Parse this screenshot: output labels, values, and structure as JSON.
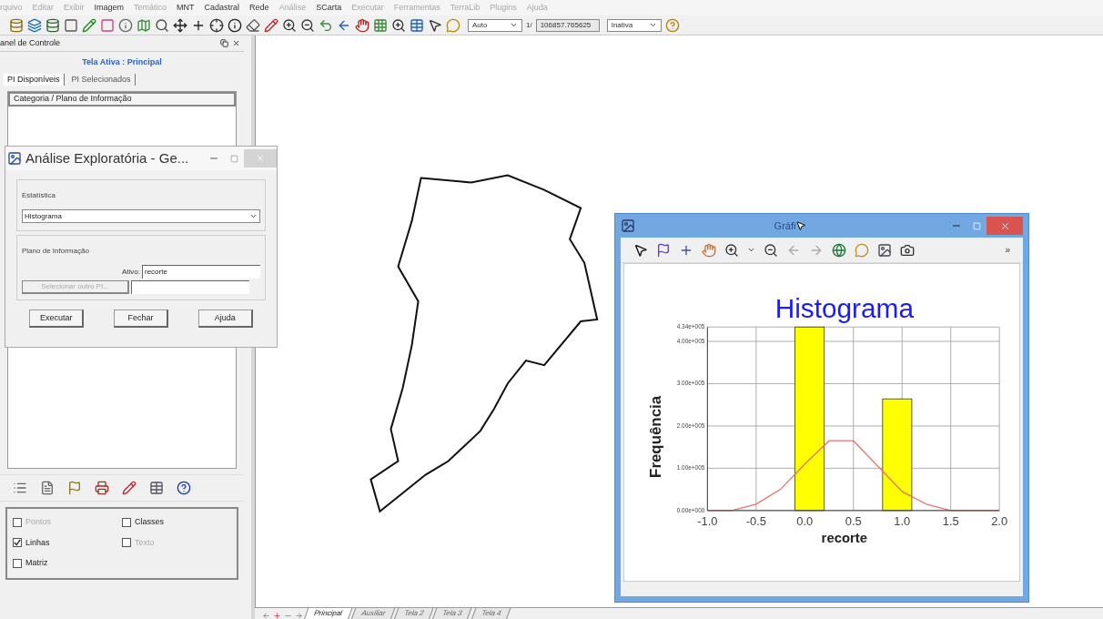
{
  "menu": [
    {
      "label": "rquivo",
      "disabled": true
    },
    {
      "label": "Editar",
      "disabled": true
    },
    {
      "label": "Exibir",
      "disabled": true
    },
    {
      "label": "Imagem",
      "disabled": false
    },
    {
      "label": "Temático",
      "disabled": true
    },
    {
      "label": "MNT",
      "disabled": false
    },
    {
      "label": "Cadastral",
      "disabled": false
    },
    {
      "label": "Rede",
      "disabled": false
    },
    {
      "label": "Análise",
      "disabled": true
    },
    {
      "label": "SCarta",
      "disabled": false
    },
    {
      "label": "Executar",
      "disabled": true
    },
    {
      "label": "Ferramentas",
      "disabled": true
    },
    {
      "label": "TerraLib",
      "disabled": true
    },
    {
      "label": "Plugins",
      "disabled": true
    },
    {
      "label": "Ajuda",
      "disabled": true
    }
  ],
  "toolbar": {
    "zoom_mode": "Auto",
    "scale_prefix": "1/",
    "scale": "106857.765625",
    "status": "Inativa"
  },
  "control_panel": {
    "title": "anel de Controle",
    "active_view": "Tela Ativa : Principal",
    "tabs": [
      {
        "label": "PI Disponíveis",
        "selected": true
      },
      {
        "label": "PI Selecionados",
        "selected": false
      }
    ],
    "tree_header": "Categoria / Plano de Informação",
    "options": [
      {
        "label": "Pontos",
        "checked": false,
        "disabled": true
      },
      {
        "label": "Classes",
        "checked": false,
        "disabled": false
      },
      {
        "label": "Linhas",
        "checked": true,
        "disabled": false
      },
      {
        "label": "Texto",
        "checked": false,
        "disabled": true
      },
      {
        "label": "Matriz",
        "checked": false,
        "disabled": false
      }
    ]
  },
  "dialog": {
    "title": "Análise Exploratória - Ge...",
    "statistic_group": "Estatística",
    "statistic": "Histograma",
    "layer_group": "Plano de Informação",
    "active_label": "Ativo:",
    "active_value": "recorte",
    "select_button": "Selecionar outro PI...",
    "buttons": [
      "Executar",
      "Fechar",
      "Ajuda"
    ]
  },
  "view_tabs": [
    {
      "label": "Principal",
      "selected": true
    },
    {
      "label": "Auxiliar",
      "selected": false
    },
    {
      "label": "Tela 2",
      "selected": false
    },
    {
      "label": "Tela 3",
      "selected": false
    },
    {
      "label": "Tela 4",
      "selected": false
    }
  ],
  "chart_window": {
    "title": "Gráfi",
    "more": "»",
    "chart_data": {
      "type": "bar",
      "title": "Histograma",
      "xlabel": "recorte",
      "ylabel": "Frequência",
      "grid": true,
      "series": [
        {
          "color": "#ffff00",
          "x": [
            0.05,
            0.95
          ],
          "values": [
            434000,
            264000
          ]
        },
        {
          "type": "line",
          "color": "#e87070",
          "x": [
            -1,
            -0.75,
            -0.5,
            -0.25,
            0,
            0.25,
            0.5,
            0.75,
            1,
            1.25,
            1.5,
            1.75,
            2
          ],
          "values": [
            0,
            0,
            15000,
            50000,
            110000,
            165000,
            165000,
            105000,
            45000,
            15000,
            0,
            0,
            0
          ]
        }
      ],
      "xlim": [
        -1,
        2
      ],
      "ylim": [
        0,
        434000
      ],
      "xticks": [
        {
          "value": -1,
          "label": "-1.0"
        },
        {
          "value": -0.5,
          "label": "-0.5"
        },
        {
          "value": 0,
          "label": "0.0"
        },
        {
          "value": 0.5,
          "label": "0.5"
        },
        {
          "value": 1,
          "label": "1.0"
        },
        {
          "value": 1.5,
          "label": "1.5"
        },
        {
          "value": 2,
          "label": "2.0"
        }
      ],
      "yticks": [
        {
          "value": 0,
          "label": "0.00e+000"
        },
        {
          "value": 100000,
          "label": "1.00e+005"
        },
        {
          "value": 200000,
          "label": "2.00e+005"
        },
        {
          "value": 300000,
          "label": "3.00e+005"
        },
        {
          "value": 400000,
          "label": "4.00e+005"
        },
        {
          "value": 434000,
          "label": "4.34e+005"
        }
      ]
    }
  }
}
